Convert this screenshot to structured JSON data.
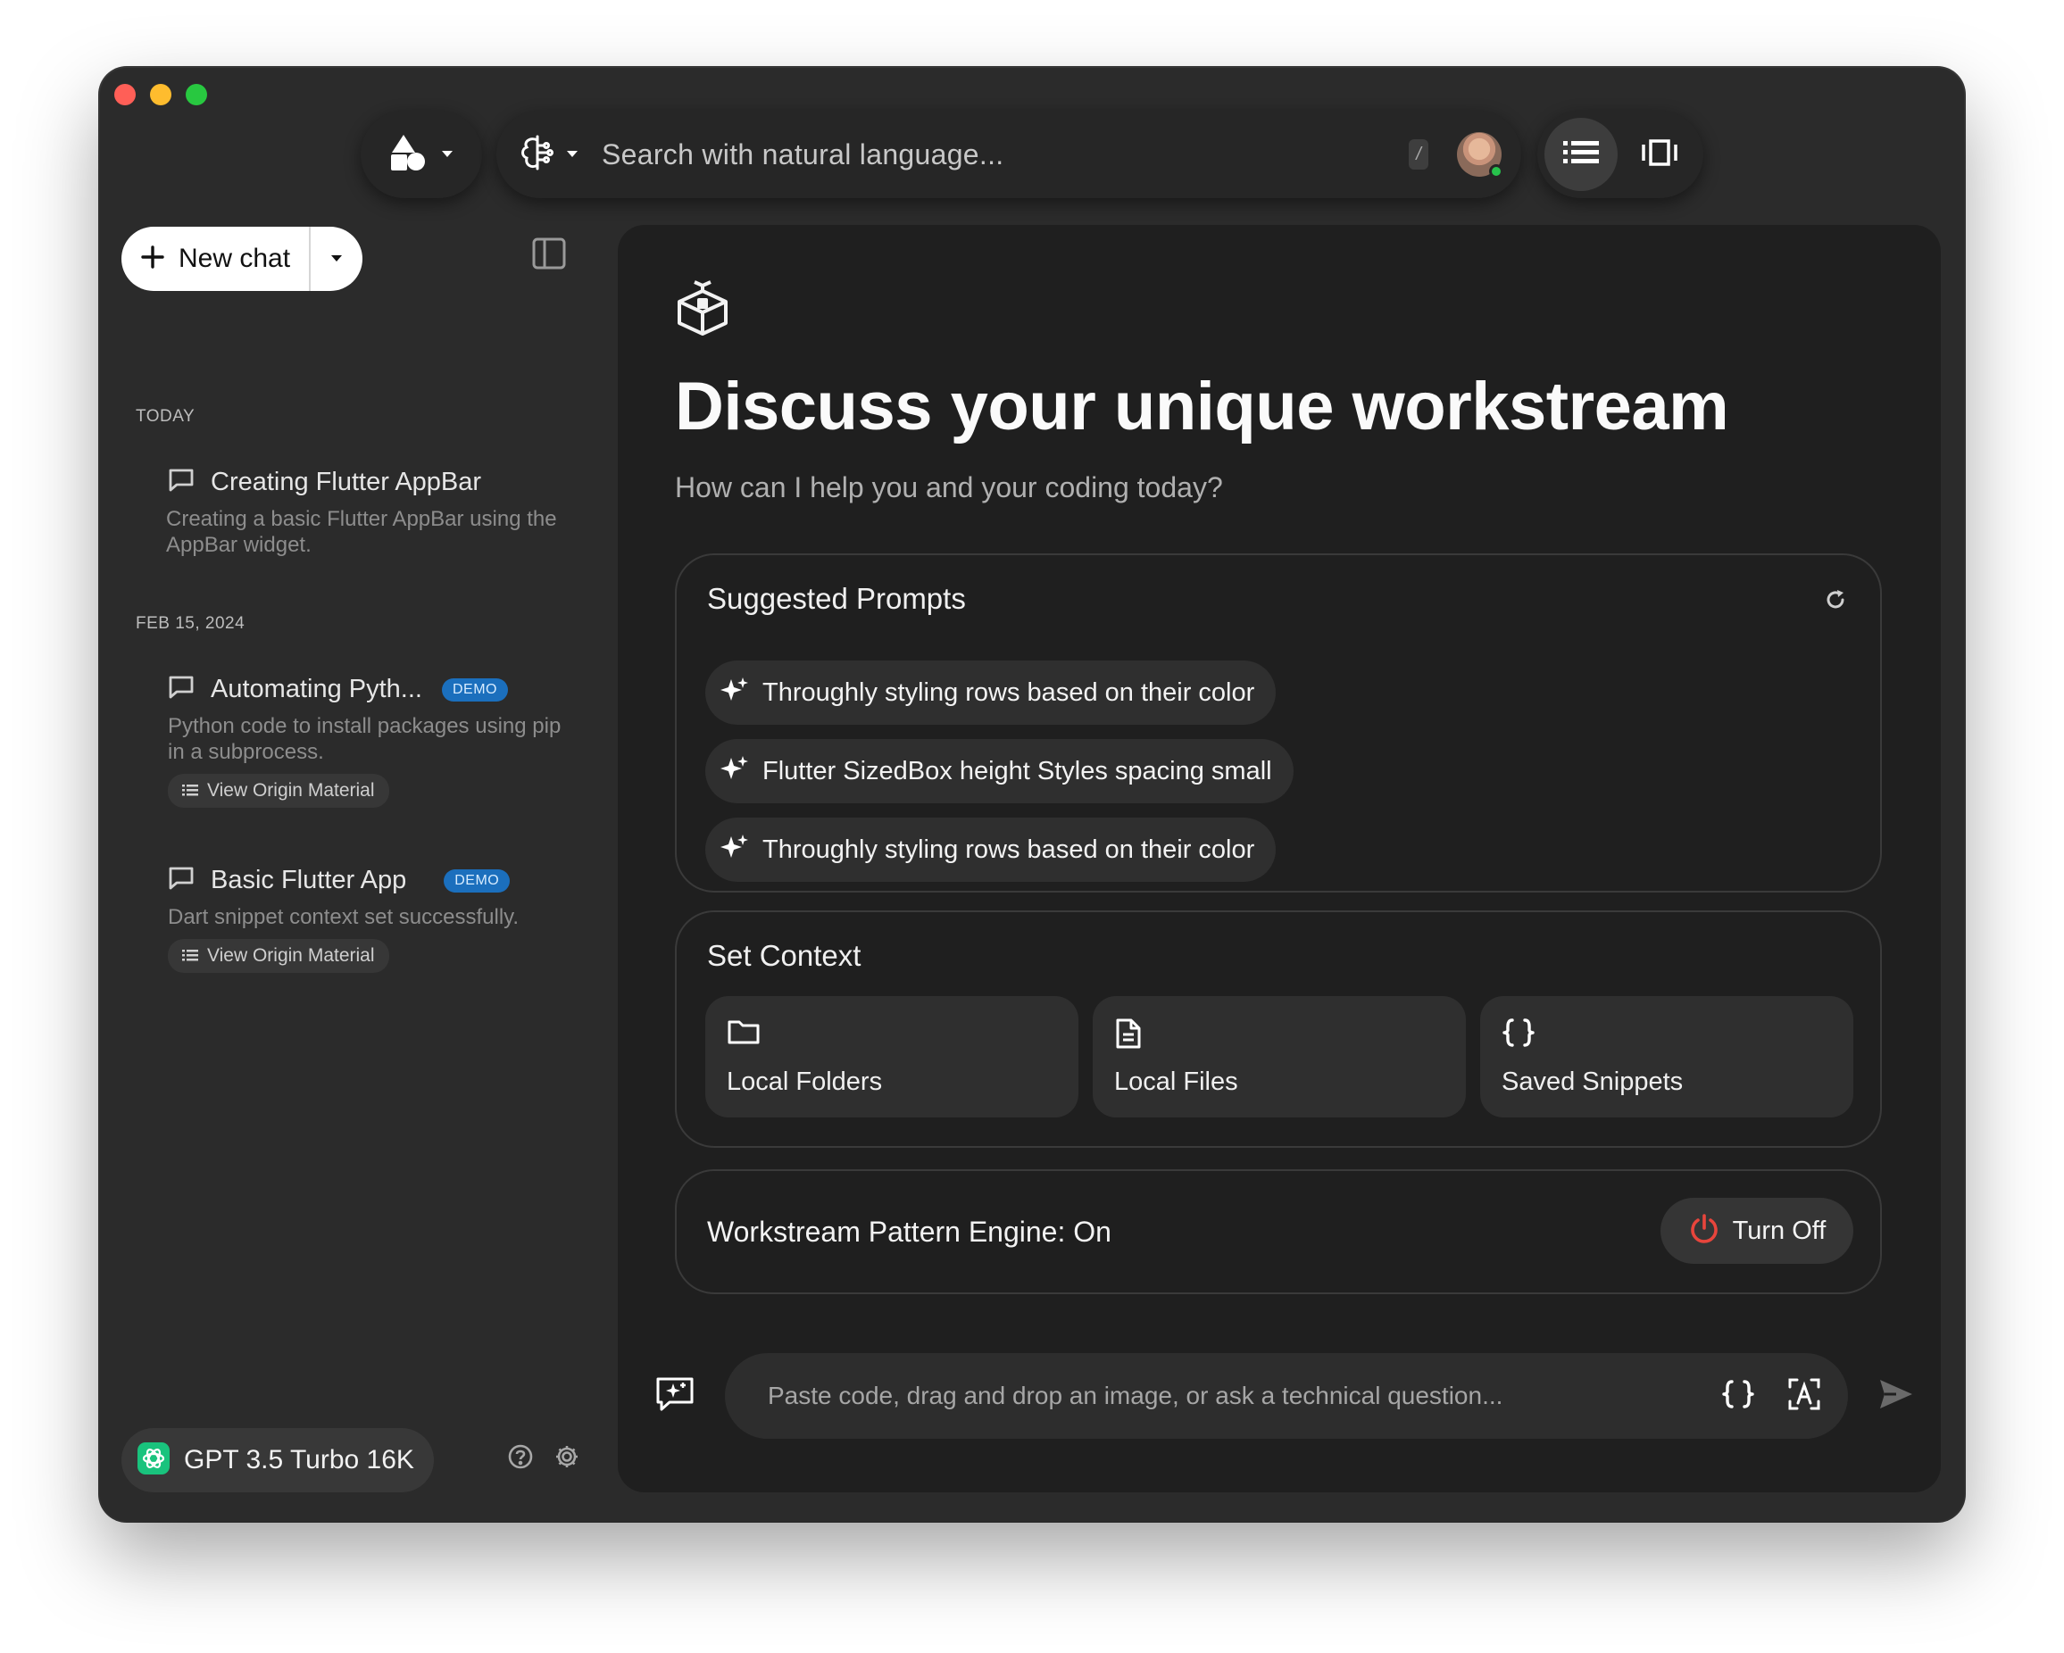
{
  "topbar": {
    "search_placeholder": "Search with natural language...",
    "shortcut_key": "/"
  },
  "sidebar": {
    "new_chat_label": "New chat",
    "groups": [
      {
        "label": "TODAY",
        "items": [
          {
            "title": "Creating Flutter AppBar",
            "description": "Creating a basic Flutter AppBar using the AppBar widget.",
            "badge": "",
            "origin_label": ""
          }
        ]
      },
      {
        "label": "FEB 15, 2024",
        "items": [
          {
            "title": "Automating Pyth...",
            "description": "Python code to install packages using pip in a subprocess.",
            "badge": "DEMO",
            "origin_label": "View Origin Material"
          },
          {
            "title": "Basic Flutter App",
            "description": "Dart snippet context set successfully.",
            "badge": "DEMO",
            "origin_label": "View Origin Material"
          }
        ]
      }
    ],
    "model_label": "GPT 3.5 Turbo 16K"
  },
  "main": {
    "title": "Discuss your unique workstream",
    "subtitle": "How can I help you and your coding today?",
    "suggested": {
      "title": "Suggested Prompts",
      "prompts": [
        "Throughly styling rows based on their color",
        "Flutter SizedBox height Styles spacing small",
        "Throughly styling rows based on their color"
      ]
    },
    "context": {
      "title": "Set Context",
      "tiles": [
        "Local Folders",
        "Local Files",
        "Saved Snippets"
      ]
    },
    "engine": {
      "label": "Workstream Pattern Engine: On",
      "button_label": "Turn Off"
    },
    "composer_placeholder": "Paste code, drag and drop an image, or ask a technical question..."
  },
  "colors": {
    "window_bg": "#2b2b2b",
    "main_bg": "#1f1f1f",
    "demo_badge": "#1b6fbd",
    "power_icon": "#e8453c",
    "status_online": "#27c24c"
  },
  "icons": {
    "logo": "shapes-icon",
    "search_mode": "brain-icon",
    "list_view": "list-icon",
    "carousel_view": "carousel-icon",
    "hero": "box-icon",
    "prompt": "sparkle-icon"
  }
}
